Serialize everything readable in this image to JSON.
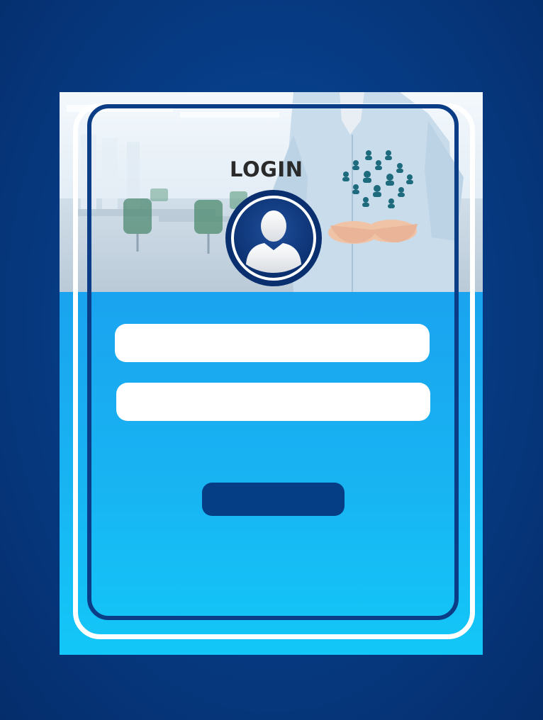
{
  "login": {
    "title": "LOGIN",
    "username_placeholder": "",
    "password_placeholder": "",
    "submit_label": ""
  },
  "icons": {
    "avatar": "user-avatar-icon",
    "network": "people-network-icon"
  },
  "colors": {
    "background": "#063a82",
    "panel": "#18b3f2",
    "frame_inner": "#0b3d86",
    "frame_outer": "#ffffff",
    "button": "#063e86"
  }
}
